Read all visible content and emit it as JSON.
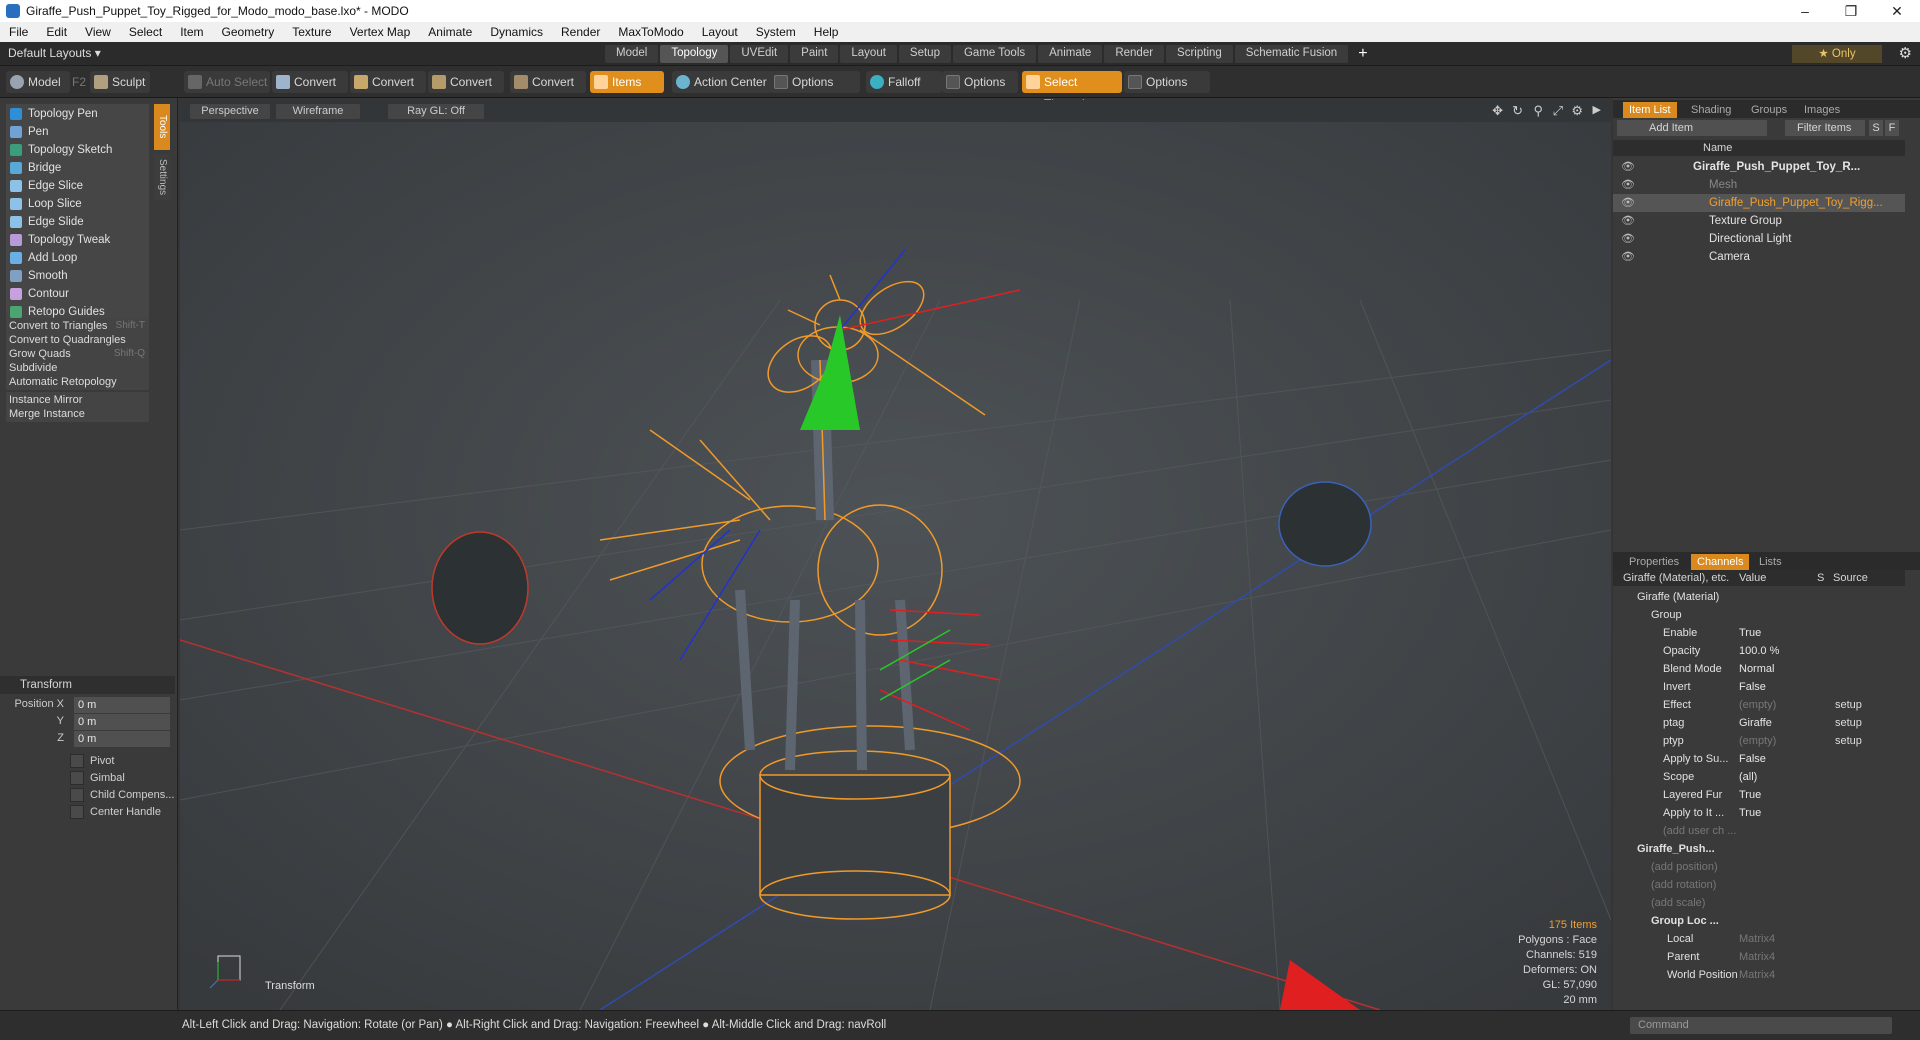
{
  "window": {
    "title": "Giraffe_Push_Puppet_Toy_Rigged_for_Modo_modo_base.lxo* - MODO"
  },
  "menu": [
    "File",
    "Edit",
    "View",
    "Select",
    "Item",
    "Geometry",
    "Texture",
    "Vertex Map",
    "Animate",
    "Dynamics",
    "Render",
    "MaxToModo",
    "Layout",
    "System",
    "Help"
  ],
  "layouts": {
    "dropdown": "Default Layouts ▾",
    "tabs": [
      "Model",
      "Topology",
      "UVEdit",
      "Paint",
      "Layout",
      "Setup",
      "Game Tools",
      "Animate",
      "Render",
      "Scripting",
      "Schematic Fusion"
    ],
    "active": "Topology",
    "only": "★ Only"
  },
  "toolbar": {
    "model": "Model",
    "f2": "F2",
    "sculpt": "Sculpt",
    "auto_select": "Auto Select",
    "convert": "Convert",
    "items": "Items",
    "action_center": "Action Center",
    "options": "Options",
    "falloff": "Falloff",
    "select_through": "Select Through"
  },
  "tools": [
    "Topology Pen",
    "Pen",
    "Topology Sketch",
    "Bridge",
    "Edge Slice",
    "Loop Slice",
    "Edge Slide",
    "Topology Tweak",
    "Add Loop",
    "Smooth",
    "Contour",
    "Retopo Guides"
  ],
  "tool_colors": [
    "#2e8ed6",
    "#6fa3d8",
    "#3a9e7a",
    "#58a8d8",
    "#8cc1e8",
    "#8cc1e8",
    "#8cc1e8",
    "#b79ad8",
    "#6ab0e6",
    "#7fa0c4",
    "#c7a0e0",
    "#4aa66e"
  ],
  "text_tools": [
    {
      "label": "Convert to Triangles",
      "shortcut": "Shift-T"
    },
    {
      "label": "Convert to Quadrangles",
      "shortcut": ""
    },
    {
      "label": "Grow Quads",
      "shortcut": "Shift-Q"
    },
    {
      "label": "Subdivide",
      "shortcut": ""
    },
    {
      "label": "Automatic Retopology",
      "shortcut": ""
    },
    {
      "label": "Instance Mirror",
      "shortcut": ""
    },
    {
      "label": "Merge Instance",
      "shortcut": ""
    }
  ],
  "side_tabs": [
    "Tools",
    "Settings"
  ],
  "transform": {
    "header": "Transform",
    "pos_x_label": "Position X",
    "y_label": "Y",
    "z_label": "Z",
    "x": "0 m",
    "y": "0 m",
    "z": "0 m",
    "options": [
      "Pivot",
      "Gimbal",
      "Child Compens...",
      "Center Handle"
    ]
  },
  "viewport": {
    "perspective": "Perspective",
    "wireframe": "Wireframe",
    "raygl": "Ray GL: Off",
    "mode_label": "Transform",
    "stats": {
      "items": "175 Items",
      "polygons": "Polygons : Face",
      "channels": "Channels: 519",
      "deformers": "Deformers: ON",
      "gl": "GL: 57,090",
      "scale": "20 mm"
    }
  },
  "item_list": {
    "tabs": [
      "Item List",
      "Shading",
      "Groups",
      "Images"
    ],
    "add_item": "Add Item",
    "filter": "Filter Items",
    "s": "S",
    "f": "F",
    "name_col": "Name",
    "rows": [
      "Giraffe_Push_Puppet_Toy_R...",
      "Mesh",
      "Giraffe_Push_Puppet_Toy_Rigg...",
      "Texture Group",
      "Directional Light",
      "Camera"
    ]
  },
  "channels": {
    "tabs": [
      "Properties",
      "Channels",
      "Lists"
    ],
    "header": [
      "Giraffe (Material), etc.",
      "Value",
      "S",
      "Source"
    ],
    "rows": [
      {
        "name": "Giraffe (Material)",
        "value": "",
        "source": ""
      },
      {
        "name": "Group",
        "value": "",
        "source": ""
      },
      {
        "name": "Enable",
        "value": "True",
        "source": ""
      },
      {
        "name": "Opacity",
        "value": "100.0 %",
        "source": ""
      },
      {
        "name": "Blend Mode",
        "value": "Normal",
        "source": ""
      },
      {
        "name": "Invert",
        "value": "False",
        "source": ""
      },
      {
        "name": "Effect",
        "value": "(empty)",
        "source": "setup"
      },
      {
        "name": "ptag",
        "value": "Giraffe",
        "source": "setup"
      },
      {
        "name": "ptyp",
        "value": "(empty)",
        "source": "setup"
      },
      {
        "name": "Apply to Su...",
        "value": "False",
        "source": ""
      },
      {
        "name": "Scope",
        "value": "(all)",
        "source": ""
      },
      {
        "name": "Layered Fur",
        "value": "True",
        "source": ""
      },
      {
        "name": "Apply to It ...",
        "value": "True",
        "source": ""
      },
      {
        "name": "(add user ch ...",
        "value": "",
        "source": ""
      },
      {
        "name": "Giraffe_Push...",
        "value": "",
        "source": ""
      },
      {
        "name": "(add position)",
        "value": "",
        "source": ""
      },
      {
        "name": "(add rotation)",
        "value": "",
        "source": ""
      },
      {
        "name": "(add scale)",
        "value": "",
        "source": ""
      },
      {
        "name": "Group Loc ...",
        "value": "",
        "source": ""
      },
      {
        "name": "Local",
        "value": "Matrix4",
        "source": ""
      },
      {
        "name": "Parent",
        "value": "Matrix4",
        "source": ""
      },
      {
        "name": "World Position",
        "value": "Matrix4",
        "source": ""
      }
    ]
  },
  "status": {
    "message": "Alt-Left Click and Drag: Navigation: Rotate (or Pan) ● Alt-Right Click and Drag: Navigation: Freewheel ● Alt-Middle Click and Drag: navRoll",
    "command_placeholder": "Command"
  }
}
